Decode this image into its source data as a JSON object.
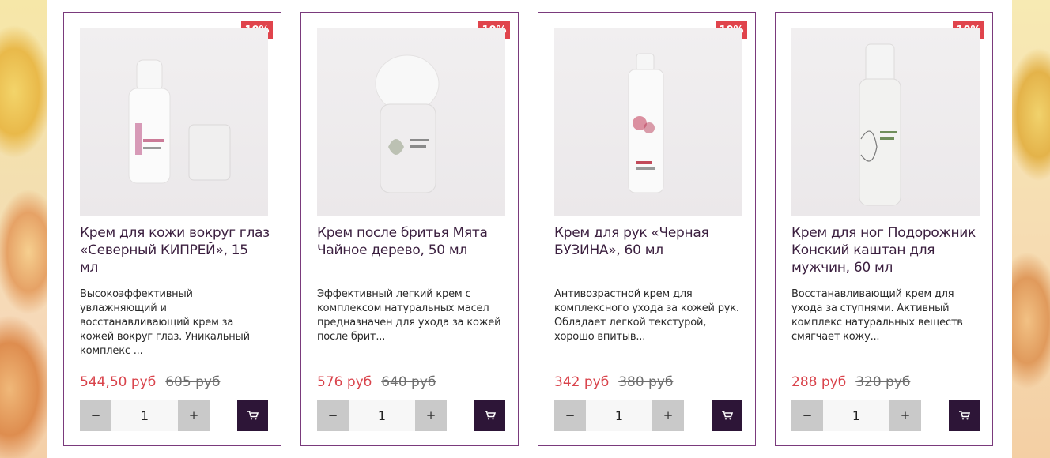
{
  "products": [
    {
      "badge": "10%",
      "title": "Крем для кожи вокруг глаз «Северный КИПРЕЙ», 15 мл",
      "description": "Высокоэффективный увлажняющий и восстанавливающий крем за кожей вокруг глаз. Уникальный комплекс ...",
      "price": "544,50 руб",
      "old_price": "605 руб",
      "quantity": "1",
      "minus_label": "−",
      "plus_label": "+",
      "cart_icon": "cart-icon"
    },
    {
      "badge": "10%",
      "title": "Крем после бритья Мята Чайное дерево, 50 мл",
      "description": "Эффективный легкий крем с комплексом натуральных масел предназначен для ухода за кожей после брит...",
      "price": "576 руб",
      "old_price": "640 руб",
      "quantity": "1",
      "minus_label": "−",
      "plus_label": "+",
      "cart_icon": "cart-icon"
    },
    {
      "badge": "10%",
      "title": "Крем для рук «Черная БУЗИНА», 60 мл",
      "description": "Антивозрастной крем для комплексного ухода за кожей рук. Обладает легкой текстурой, хорошо впитыв...",
      "price": "342 руб",
      "old_price": "380 руб",
      "quantity": "1",
      "minus_label": "−",
      "plus_label": "+",
      "cart_icon": "cart-icon"
    },
    {
      "badge": "10%",
      "title": "Крем для ног Подорожник Конский каштан для мужчин, 60 мл",
      "description": "Восстанавливающий крем для ухода за ступнями. Активный комплекс натуральных веществ смягчает кожу...",
      "price": "288 руб",
      "old_price": "320 руб",
      "quantity": "1",
      "minus_label": "−",
      "plus_label": "+",
      "cart_icon": "cart-icon"
    }
  ],
  "colors": {
    "card_border": "#7a3a7c",
    "badge_bg": "#e0444c",
    "price": "#d9434b",
    "cart_bg": "#2d1537",
    "title": "#3b1f3f"
  }
}
